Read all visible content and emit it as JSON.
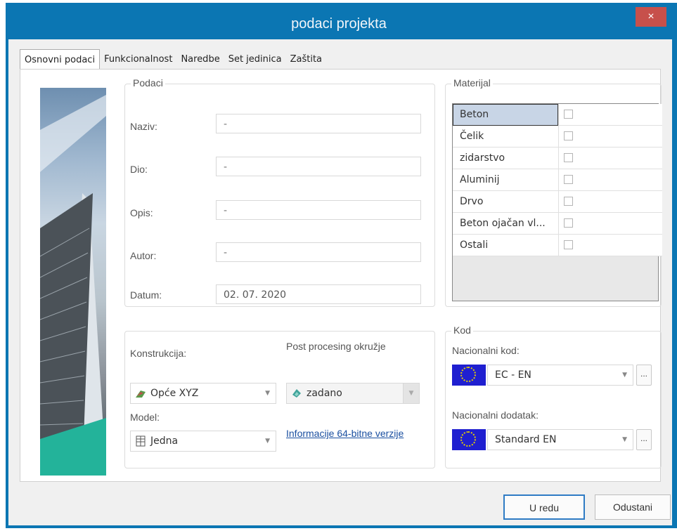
{
  "window": {
    "title": "podaci projekta",
    "close_glyph": "×"
  },
  "tabs": [
    "Osnovni podaci",
    "Funkcionalnost",
    "Naredbe",
    "Set jedinica",
    "Zaštita"
  ],
  "podaci": {
    "title": "Podaci",
    "fields": [
      {
        "label": "Naziv:",
        "value": "-"
      },
      {
        "label": "Dio:",
        "value": "-"
      },
      {
        "label": "Opis:",
        "value": "-"
      },
      {
        "label": "Autor:",
        "value": "-"
      },
      {
        "label": "Datum:",
        "value": "02. 07. 2020"
      }
    ]
  },
  "konstrukcija": {
    "label": "Konstrukcija:",
    "value": "Opće XYZ",
    "model_label": "Model:",
    "model_value": "Jedna"
  },
  "post": {
    "label": "Post procesing okružje",
    "value": "zadano",
    "link": "Informacije 64-bitne verzije"
  },
  "materijal": {
    "title": "Materijal",
    "rows": [
      {
        "name": "Beton",
        "checked": false,
        "selected": true
      },
      {
        "name": "Čelik",
        "checked": false
      },
      {
        "name": "zidarstvo",
        "checked": false
      },
      {
        "name": "Aluminij",
        "checked": false
      },
      {
        "name": "Drvo",
        "checked": false
      },
      {
        "name": "Beton ojačan vl...",
        "checked": false
      },
      {
        "name": "Ostali",
        "checked": false
      }
    ]
  },
  "kod": {
    "title": "Kod",
    "nacionalni_kod_label": "Nacionalni kod:",
    "nacionalni_kod_value": "EC - EN",
    "dodatak_label": "Nacionalni dodatak:",
    "dodatak_value": "Standard EN",
    "ellipsis": "..."
  },
  "buttons": {
    "ok": "U redu",
    "cancel": "Odustani"
  },
  "icons": {
    "construction": "construction-crane-icon",
    "post": "post-processing-icon",
    "model": "model-icon",
    "flag": "eu-flag-icon"
  },
  "colors": {
    "titlebar": "#0b76b3",
    "close": "#c7504b",
    "default_button_border": "#2e7bc4",
    "link": "#1a4fa0"
  }
}
